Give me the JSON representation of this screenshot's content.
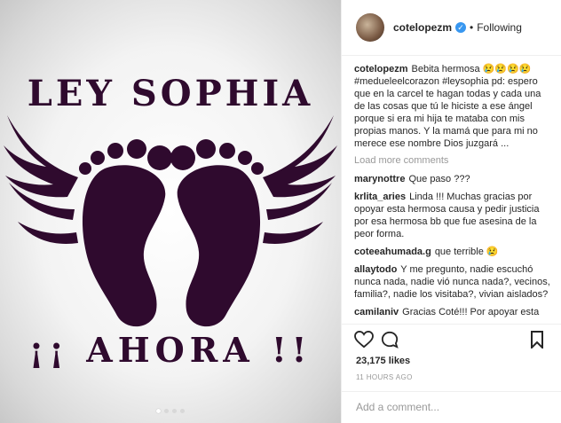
{
  "image": {
    "title_top": "LEY SOPHIA",
    "title_bottom": "¡¡ AHORA !!",
    "colors": {
      "ink": "#2f0a2e",
      "background": "#f0f0f0"
    },
    "carousel_total": 4,
    "carousel_active": 1
  },
  "header": {
    "username": "cotelopezm",
    "verified_icon": "verified-badge-icon",
    "separator": "•",
    "follow_status": "Following"
  },
  "caption": {
    "username": "cotelopezm",
    "text": "Bebita hermosa 😢😢😢😢 #medueleelcorazon #leysophia pd: espero que en la carcel te hagan todas y cada una de las cosas que tú le hiciste a ese ángel porque si era mi hija te mataba con mis propias manos. Y la mamá que para mi no merece ese nombre Dios juzgará ..."
  },
  "load_more": "Load more comments",
  "comments": [
    {
      "username": "marynottre",
      "text": "Que paso ???"
    },
    {
      "username": "krlita_aries",
      "text": "Linda !!! Muchas gracias por opoyar esta hermosa causa y pedir justicia por esa hermosa bb que fue asesina de la peor forma."
    },
    {
      "username": "coteeahumada.g",
      "text": "que terrible 😢"
    },
    {
      "username": "allaytodo",
      "text": "Y me pregunto, nadie escuchó nunca nada, nadie vió nunca nada?, vecinos, familia?, nadie los visitaba?, vivian aislados?"
    },
    {
      "username": "camilaniv",
      "text": "Gracias Coté!!! Por apoyar esta"
    }
  ],
  "actions": {
    "like_icon": "heart-icon",
    "comment_icon": "comment-icon",
    "save_icon": "bookmark-icon"
  },
  "likes": "23,175 likes",
  "timestamp": "11 HOURS AGO",
  "add_comment_placeholder": "Add a comment..."
}
